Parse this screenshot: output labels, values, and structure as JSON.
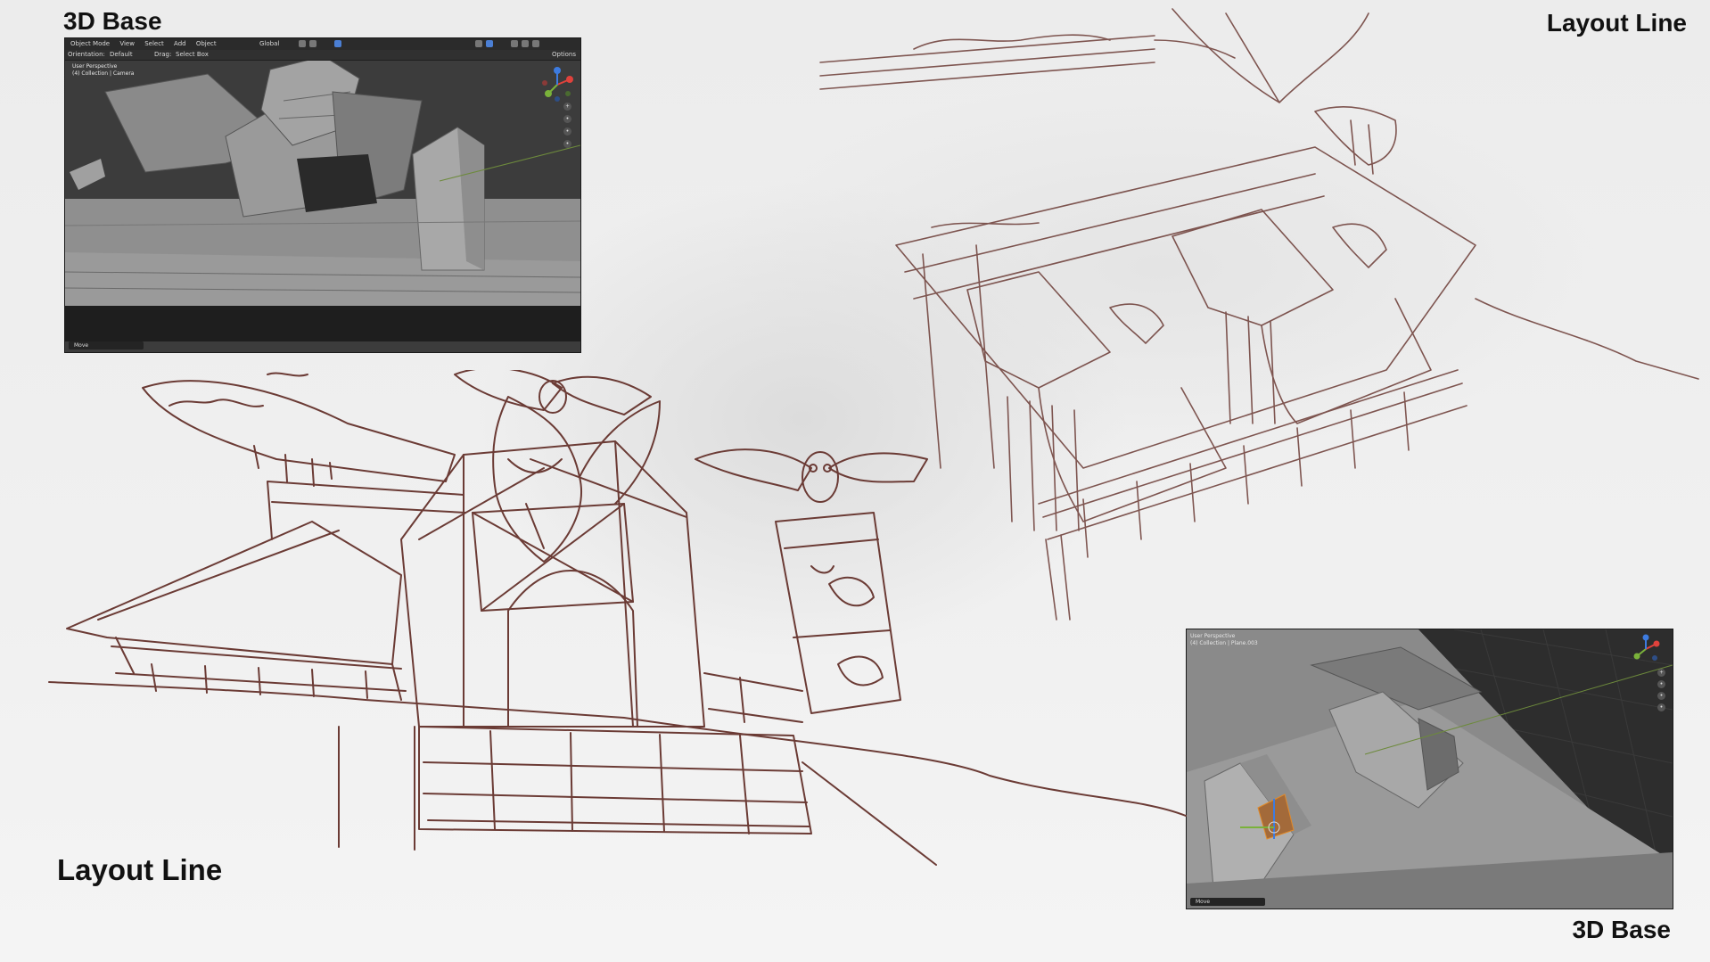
{
  "captions": {
    "top_left": "3D Base",
    "top_right": "Layout Line",
    "bottom_left": "Layout Line",
    "bottom_right": "3D Base"
  },
  "viewport_top": {
    "menu": [
      "Object Mode",
      "View",
      "Select",
      "Add",
      "Object"
    ],
    "orientation_label": "Orientation:",
    "orientation_value": "Default",
    "drag_label": "Drag:",
    "drag_value": "Select Box",
    "transform_space": "Global",
    "options_label": "Options",
    "overlay_line1": "User Perspective",
    "overlay_line2": "(4) Collection | Camera",
    "status": "Move"
  },
  "viewport_bottom": {
    "overlay_line1": "User Perspective",
    "overlay_line2": "(4) Collection | Plane.003",
    "status": "Move"
  },
  "colors": {
    "line_art": "#6b3b35",
    "blender_bg": "#3a3a3a",
    "model_gray": "#8e8e8e",
    "gizmo_x": "#e0423c",
    "gizmo_y": "#7ab23a",
    "gizmo_z": "#3d7be0"
  },
  "icons": [
    "zoom-icon",
    "hand-icon",
    "camera-icon",
    "grid-icon"
  ]
}
